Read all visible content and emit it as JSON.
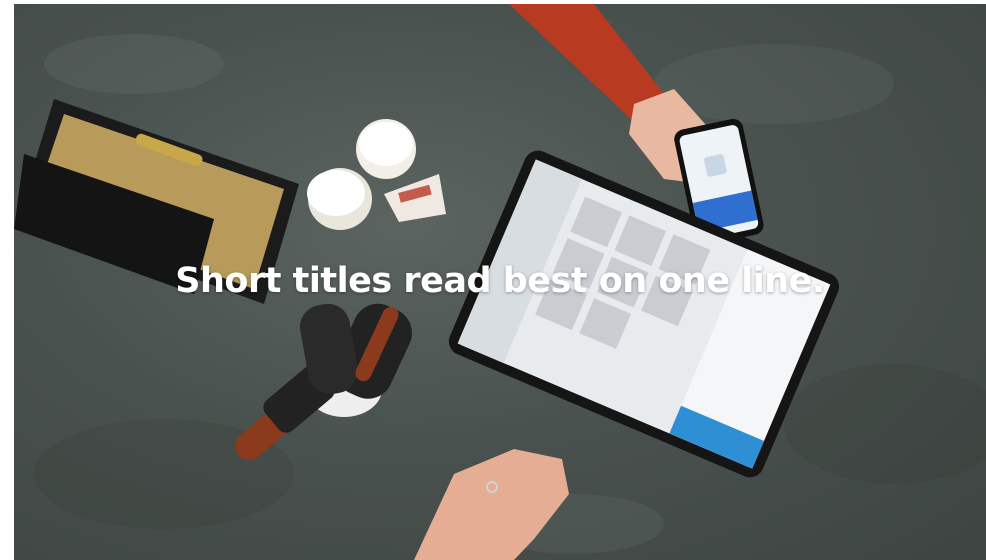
{
  "hero": {
    "title": "Short titles read best on one line.",
    "photo_description_icon": "point-of-sale-scene-photo",
    "colors": {
      "background": "#4a524f",
      "title": "#ffffff",
      "sleeve": "#c0391f",
      "tablet_accent": "#2f8fd4"
    }
  }
}
